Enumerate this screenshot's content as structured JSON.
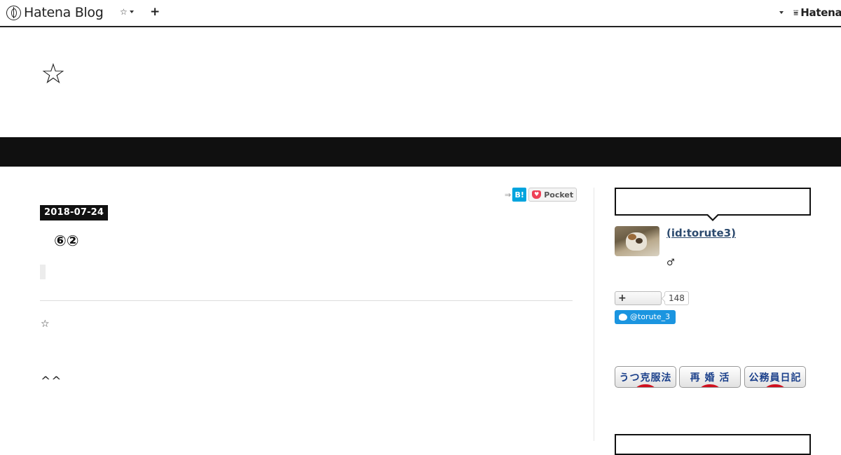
{
  "global_header": {
    "logo_text": "Hatena Blog",
    "star_menu": "☆",
    "add_button": "+",
    "hatena_text": "Hatena"
  },
  "blog": {
    "title": "☆"
  },
  "entry": {
    "share_arrow": "⇒",
    "hatena_bookmark_label": "B!",
    "pocket_label": "Pocket",
    "date": "2018-07-24",
    "title": "⑥②",
    "body_star": "☆",
    "body_smile": "^^"
  },
  "sidebar": {
    "author_id": " (id:torute3)",
    "author_sex": "♂",
    "follow_button": "+",
    "follow_count": "148",
    "twitter_label": "@torute_3",
    "banners": [
      "うつ克服法",
      "再 婚 活",
      "公務員日記"
    ]
  },
  "colors": {
    "band": "#101010",
    "hatena_bookmark": "#00a4de",
    "pocket": "#ee4056",
    "twitter": "#1b95e0",
    "banner_text": "#1a3f8a",
    "banner_dot": "#d0101e"
  }
}
